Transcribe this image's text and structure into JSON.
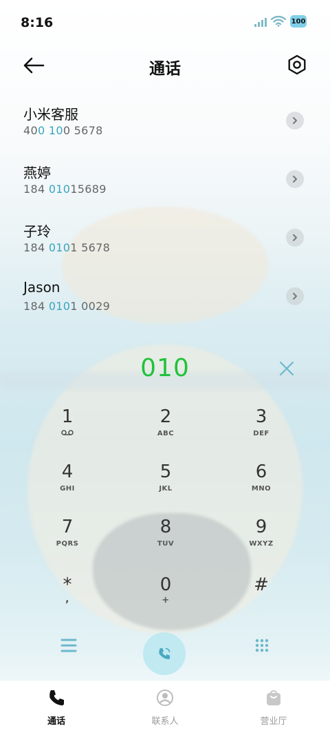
{
  "status_bar": {
    "time": "8:16",
    "battery": "100",
    "icons": [
      "signal-icon",
      "wifi-icon",
      "battery-icon"
    ]
  },
  "header": {
    "title": "通话",
    "back_icon": "back-arrow-icon",
    "settings_icon": "settings-icon"
  },
  "suggestions": [
    {
      "name": "小米客服",
      "number_parts": [
        {
          "t": "40",
          "h": false
        },
        {
          "t": "0",
          "h": true
        },
        {
          "t": " ",
          "h": false
        },
        {
          "t": "10",
          "h": true
        },
        {
          "t": "0 5678",
          "h": false
        }
      ]
    },
    {
      "name": "燕婷",
      "number_parts": [
        {
          "t": "184 ",
          "h": false
        },
        {
          "t": "010",
          "h": true
        },
        {
          "t": "15689",
          "h": false
        }
      ]
    },
    {
      "name": "子玲",
      "number_parts": [
        {
          "t": "184 ",
          "h": false
        },
        {
          "t": "010",
          "h": true
        },
        {
          "t": "1 5678",
          "h": false
        }
      ]
    },
    {
      "name": "Jason",
      "number_parts": [
        {
          "t": "184 ",
          "h": false
        },
        {
          "t": "010",
          "h": true
        },
        {
          "t": "1 0029",
          "h": false
        }
      ]
    }
  ],
  "dial_display": {
    "entered_number": "010"
  },
  "keypad": [
    {
      "digit": "1",
      "sub": "voicemail-icon"
    },
    {
      "digit": "2",
      "sub": "ABC"
    },
    {
      "digit": "3",
      "sub": "DEF"
    },
    {
      "digit": "4",
      "sub": "GHI"
    },
    {
      "digit": "5",
      "sub": "JKL"
    },
    {
      "digit": "6",
      "sub": "MNO"
    },
    {
      "digit": "7",
      "sub": "PQRS"
    },
    {
      "digit": "8",
      "sub": "TUV"
    },
    {
      "digit": "9",
      "sub": "WXYZ"
    },
    {
      "digit": "*",
      "sub": ","
    },
    {
      "digit": "0",
      "sub": "+"
    },
    {
      "digit": "#",
      "sub": ""
    }
  ],
  "action_bar": {
    "menu_icon": "menu-icon",
    "call_icon": "call-icon",
    "keypad_icon": "keypad-grid-icon"
  },
  "tabs": [
    {
      "label": "通话",
      "icon": "phone-icon",
      "active": true
    },
    {
      "label": "联系人",
      "icon": "contact-icon",
      "active": false
    },
    {
      "label": "营业厅",
      "icon": "store-bag-icon",
      "active": false
    }
  ],
  "colors": {
    "accent": "#3aa4bd",
    "entered_digits": "#21c23a",
    "call_button_bg": "#bee8f0"
  }
}
